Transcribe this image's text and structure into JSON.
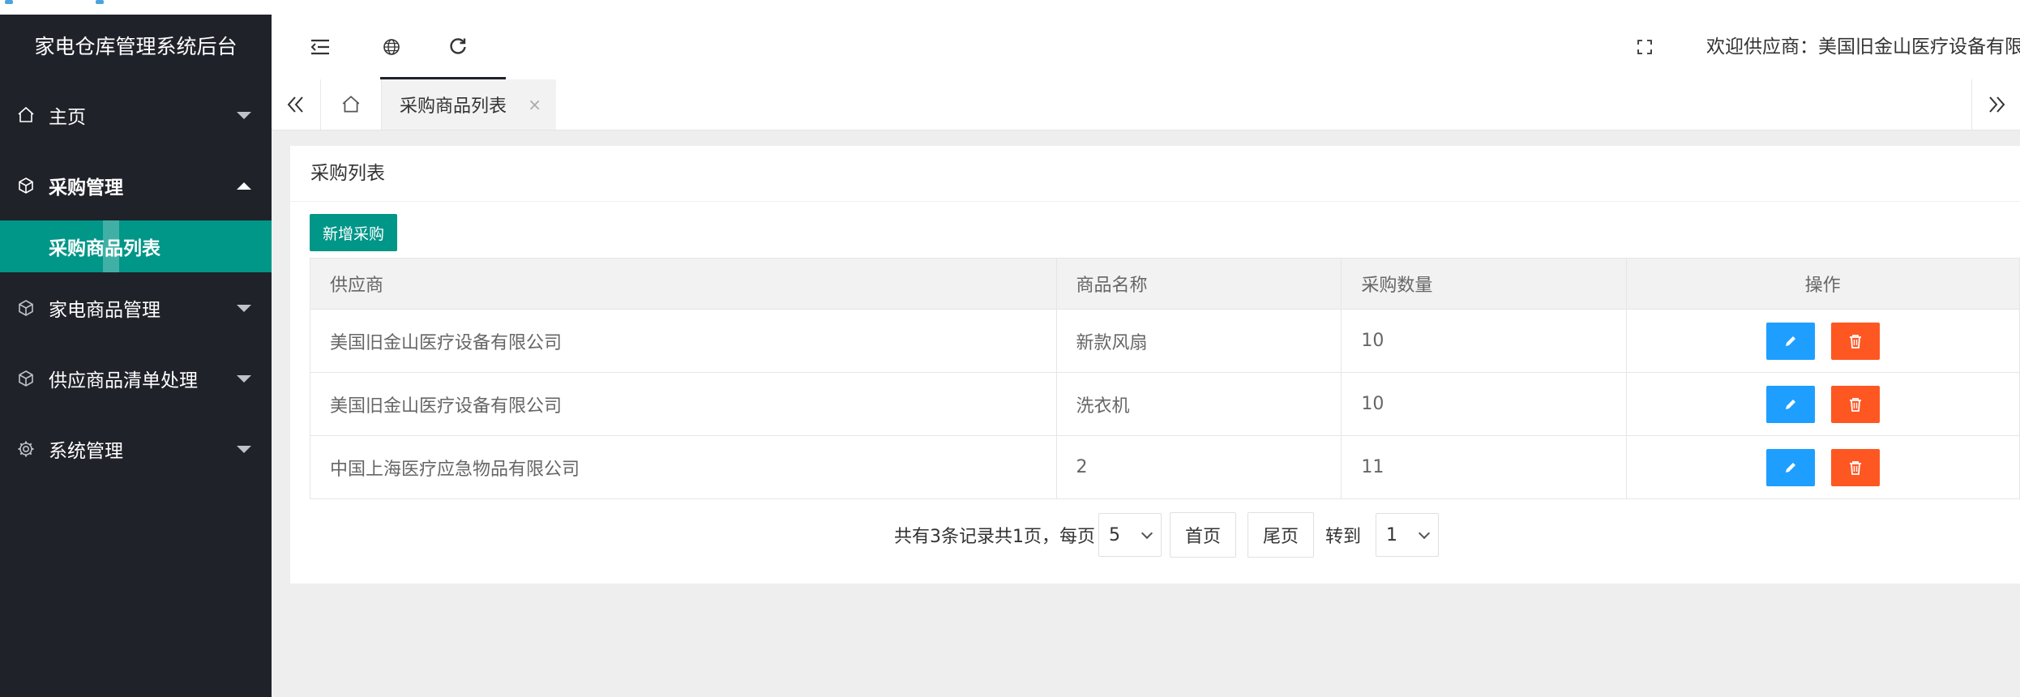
{
  "app": {
    "title": "家电仓库管理系统后台"
  },
  "sidebar": {
    "items": [
      {
        "label": "主页",
        "icon": "home-icon"
      },
      {
        "label": "采购管理",
        "icon": "cube-icon",
        "expanded": true,
        "children": [
          {
            "label": "采购商品列表",
            "active": true
          }
        ]
      },
      {
        "label": "家电商品管理",
        "icon": "cube-icon"
      },
      {
        "label": "供应商品清单处理",
        "icon": "cube-icon"
      },
      {
        "label": "系统管理",
        "icon": "gear-icon"
      }
    ]
  },
  "header": {
    "icons": [
      "menu-collapse-icon",
      "globe-icon",
      "refresh-icon",
      "fullscreen-icon"
    ],
    "welcome": "欢迎供应商：美国旧金山医疗设备有限公"
  },
  "tabs": {
    "active_label": "采购商品列表",
    "close_glyph": "×"
  },
  "card": {
    "title": "采购列表",
    "add_button": "新增采购"
  },
  "table": {
    "headers": [
      "供应商",
      "商品名称",
      "采购数量",
      "操作"
    ],
    "rows": [
      {
        "supplier": "美国旧金山医疗设备有限公司",
        "product": "新款风扇",
        "quantity": "10"
      },
      {
        "supplier": "美国旧金山医疗设备有限公司",
        "product": "洗衣机",
        "quantity": "10"
      },
      {
        "supplier": "中国上海医疗应急物品有限公司",
        "product": "2",
        "quantity": "11"
      }
    ]
  },
  "pager": {
    "summary": "共有3条记录共1页，每页",
    "page_size": "5",
    "first": "首页",
    "last": "尾页",
    "goto": "转到",
    "current_page": "1"
  },
  "colors": {
    "sidebar_bg": "#20222a",
    "accent": "#009688",
    "edit": "#1e9fff",
    "delete": "#ff5722"
  }
}
